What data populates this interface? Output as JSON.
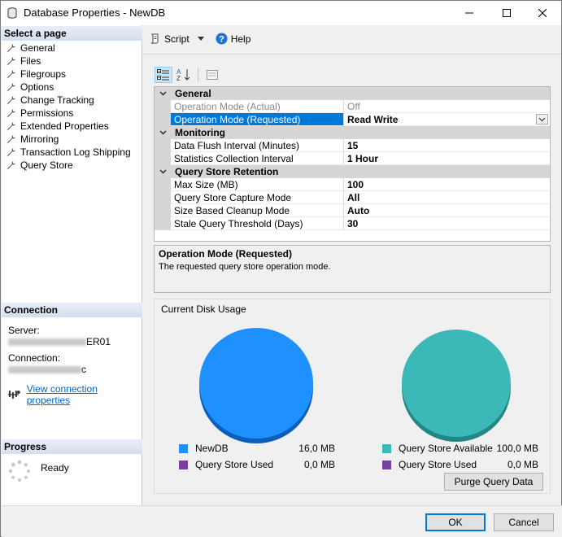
{
  "window": {
    "title": "Database Properties - NewDB"
  },
  "left": {
    "select_page_header": "Select a page",
    "pages": [
      {
        "label": "General"
      },
      {
        "label": "Files"
      },
      {
        "label": "Filegroups"
      },
      {
        "label": "Options"
      },
      {
        "label": "Change Tracking"
      },
      {
        "label": "Permissions"
      },
      {
        "label": "Extended Properties"
      },
      {
        "label": "Mirroring"
      },
      {
        "label": "Transaction Log Shipping"
      },
      {
        "label": "Query Store"
      }
    ],
    "connection_header": "Connection",
    "server_label": "Server:",
    "server_value_visible": "ER01",
    "connection_label": "Connection:",
    "connection_value_visible": "c",
    "view_connection_link": "View connection properties",
    "progress_header": "Progress",
    "progress_status": "Ready"
  },
  "toolbar": {
    "script_label": "Script",
    "help_label": "Help"
  },
  "grid": {
    "categories": [
      {
        "label": "General",
        "props": [
          {
            "name": "Operation Mode (Actual)",
            "value": "Off",
            "disabled": true
          },
          {
            "name": "Operation Mode (Requested)",
            "value": "Read Write",
            "selected": true
          }
        ]
      },
      {
        "label": "Monitoring",
        "props": [
          {
            "name": "Data Flush Interval (Minutes)",
            "value": "15"
          },
          {
            "name": "Statistics Collection Interval",
            "value": "1 Hour"
          }
        ]
      },
      {
        "label": "Query Store Retention",
        "props": [
          {
            "name": "Max Size (MB)",
            "value": "100"
          },
          {
            "name": "Query Store Capture Mode",
            "value": "All"
          },
          {
            "name": "Size Based Cleanup Mode",
            "value": "Auto"
          },
          {
            "name": "Stale Query Threshold (Days)",
            "value": "30"
          }
        ]
      }
    ]
  },
  "description": {
    "title": "Operation Mode (Requested)",
    "text": "The requested query store operation mode."
  },
  "disk_usage": {
    "title": "Current Disk Usage",
    "left_legend": [
      {
        "label": "NewDB",
        "value": "16,0 MB",
        "color": "#1e90ff"
      },
      {
        "label": "Query Store Used",
        "value": "0,0 MB",
        "color": "#7b3fa0"
      }
    ],
    "right_legend": [
      {
        "label": "Query Store Available",
        "value": "100,0 MB",
        "color": "#3cb8b8"
      },
      {
        "label": "Query Store Used",
        "value": "0,0 MB",
        "color": "#7b3fa0"
      }
    ],
    "purge_button": "Purge Query Data"
  },
  "buttons": {
    "ok": "OK",
    "cancel": "Cancel"
  },
  "colors": {
    "selection": "#0078d7",
    "newdb_pie": "#1e90ff",
    "available_pie": "#3cb8b8",
    "link": "#0066cc"
  }
}
